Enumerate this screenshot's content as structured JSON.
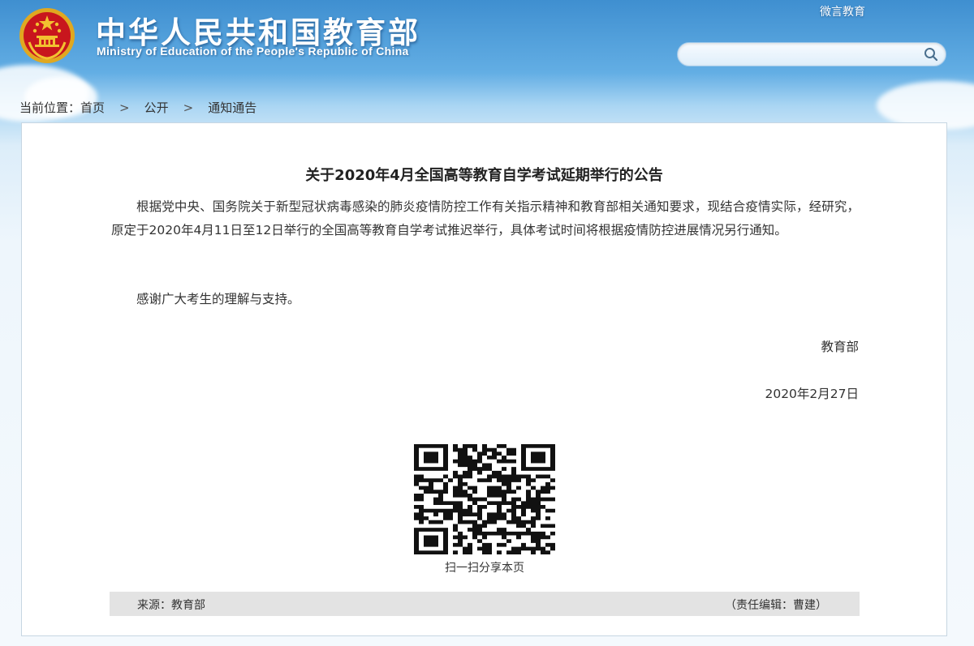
{
  "header": {
    "title": "中华人民共和国教育部",
    "subtitle": "Ministry of Education of the People's Republic of China",
    "wechat_link": "微言教育",
    "search": {
      "value": "",
      "placeholder": ""
    }
  },
  "breadcrumb": {
    "prefix": "当前位置：",
    "items": [
      "首页",
      "公开",
      "通知通告"
    ],
    "separator": ">"
  },
  "article": {
    "title": "关于2020年4月全国高等教育自学考试延期举行的公告",
    "paragraphs": [
      "根据党中央、国务院关于新型冠状病毒感染的肺炎疫情防控工作有关指示精神和教育部相关通知要求，现结合疫情实际，经研究，原定于2020年4月11日至12日举行的全国高等教育自学考试推迟举行，具体考试时间将根据疫情防控进展情况另行通知。",
      "感谢广大考生的理解与支持。"
    ],
    "signature": "教育部",
    "date": "2020年2月27日"
  },
  "qr": {
    "caption": "扫一扫分享本页"
  },
  "footer": {
    "source": "来源：教育部",
    "editor": "（责任编辑：曹建）"
  },
  "colors": {
    "header_blue": "#3f8fd0",
    "emblem_red": "#c8161d",
    "emblem_gold": "#f2c230"
  }
}
